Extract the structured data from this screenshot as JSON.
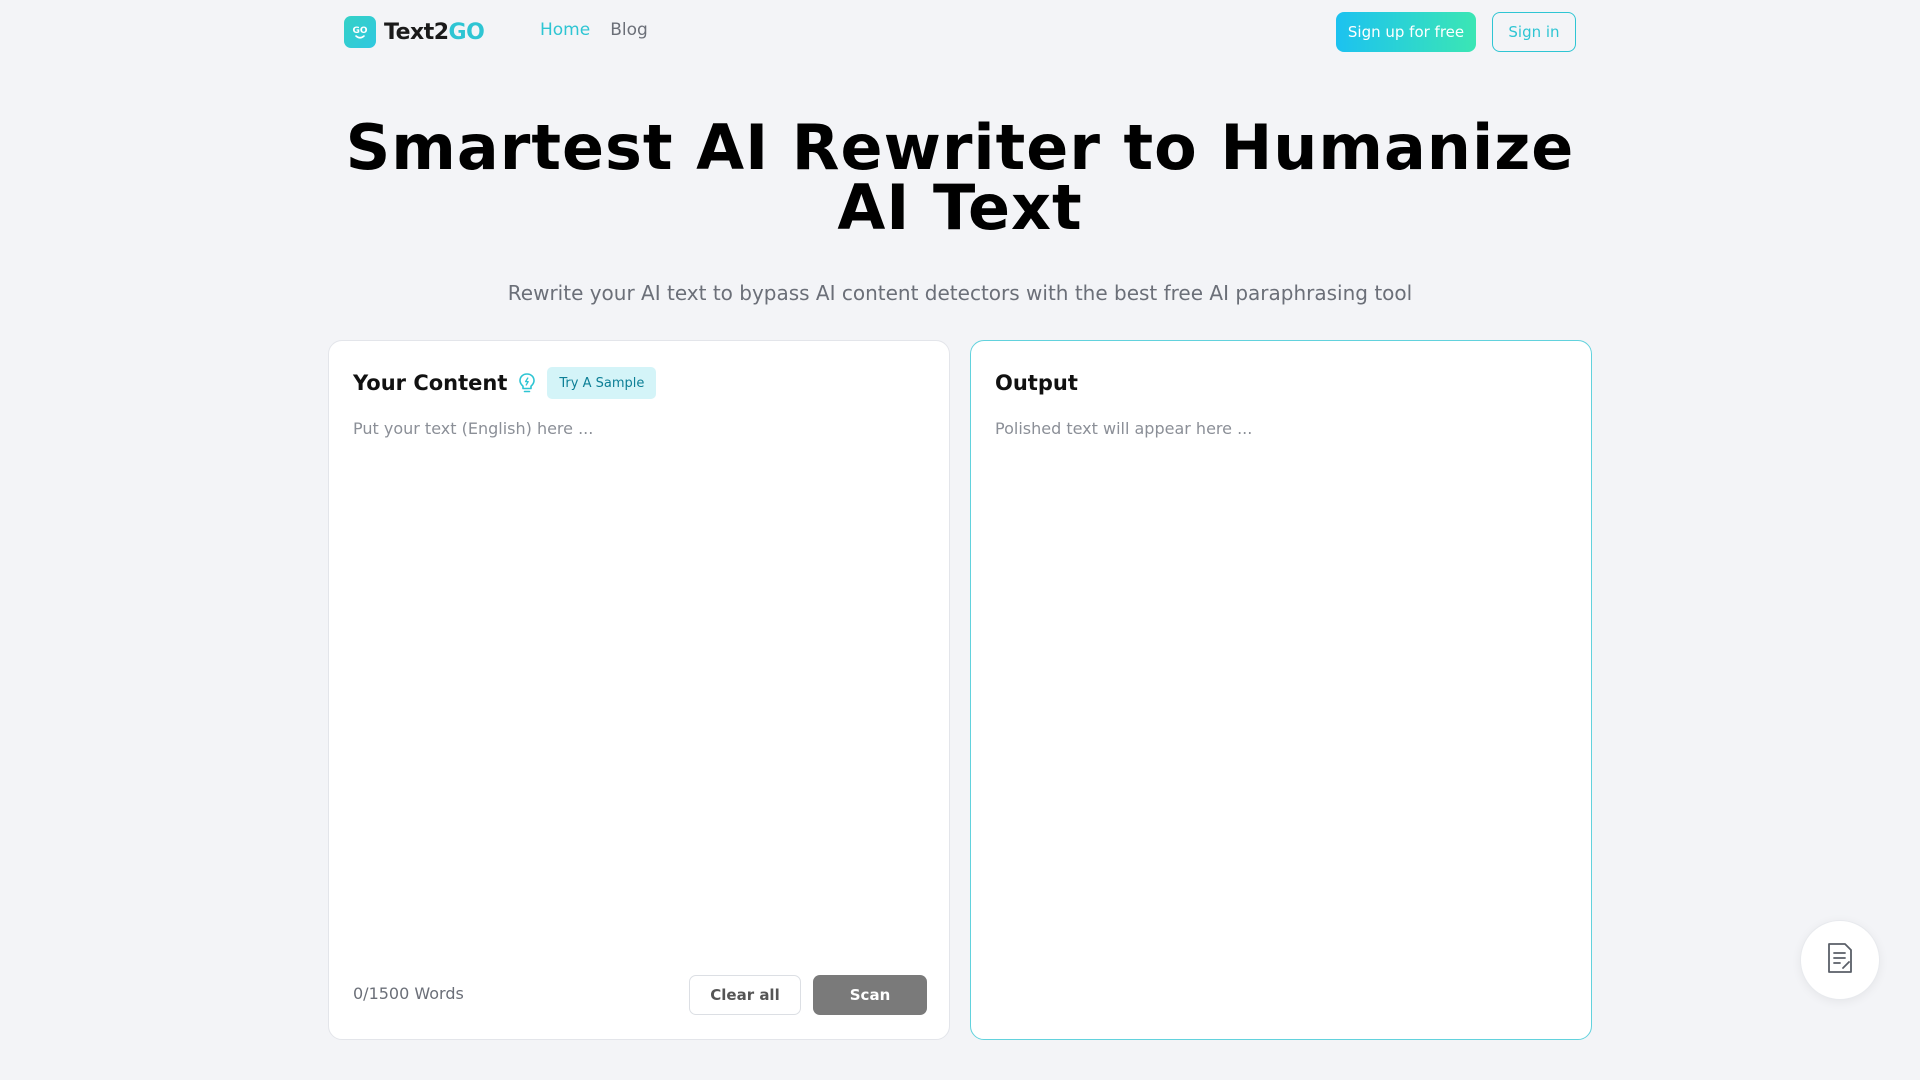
{
  "header": {
    "logo_text_main": "Text2",
    "logo_text_accent": "GO",
    "logo_mark_text": "GO",
    "nav": [
      {
        "label": "Home",
        "active": true
      },
      {
        "label": "Blog",
        "active": false
      }
    ],
    "signup_label": "Sign up for free",
    "signin_label": "Sign in"
  },
  "hero": {
    "title": "Smartest AI Rewriter to Humanize AI Text",
    "subtitle": "Rewrite your AI text to bypass AI content detectors with the best free AI paraphrasing tool"
  },
  "input_panel": {
    "title": "Your Content",
    "try_sample_label": "Try A Sample",
    "placeholder": "Put your text (English) here ...",
    "value": "",
    "word_count": "0/1500 Words",
    "clear_label": "Clear all",
    "scan_label": "Scan"
  },
  "output_panel": {
    "title": "Output",
    "placeholder": "Polished text will appear here ..."
  },
  "icons": {
    "bulb": "lightbulb-icon",
    "fab": "document-edit-icon"
  },
  "colors": {
    "accent": "#2ec5d3",
    "background": "#f3f4f7",
    "scan_button": "#7a7a7a",
    "sample_badge_bg": "#d4f4f8"
  }
}
